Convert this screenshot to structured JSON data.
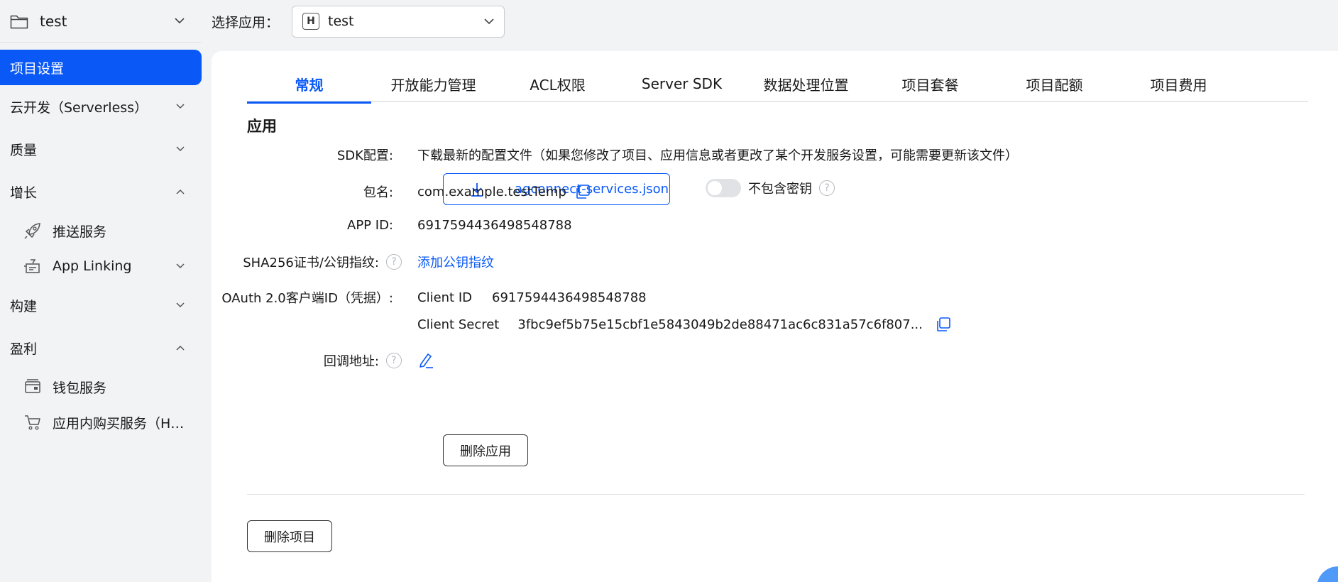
{
  "sidebar": {
    "project_name": "test",
    "items": [
      {
        "label": "项目设置",
        "active": true
      },
      {
        "label": "云开发（Serverless）",
        "expand": "down"
      },
      {
        "label": "质量",
        "expand": "down"
      },
      {
        "label": "增长",
        "expand": "up"
      },
      {
        "label": "推送服务",
        "icon": "rocket-icon"
      },
      {
        "label": "App Linking",
        "icon": "link-app-icon",
        "expand": "down"
      },
      {
        "label": "构建",
        "expand": "down"
      },
      {
        "label": "盈利",
        "expand": "up"
      },
      {
        "label": "钱包服务",
        "icon": "wallet-icon"
      },
      {
        "label": "应用内购买服务（Ha...",
        "icon": "cart-icon"
      }
    ]
  },
  "topbar": {
    "select_label": "选择应用：",
    "app_badge": "H",
    "app_value": "test"
  },
  "tabs": [
    "常规",
    "开放能力管理",
    "ACL权限",
    "Server SDK",
    "数据处理位置",
    "项目套餐",
    "项目配额",
    "项目费用"
  ],
  "app_section": {
    "title": "应用",
    "sdk_label": "SDK配置:",
    "sdk_desc": "下载最新的配置文件（如果您修改了项目、应用信息或者更改了某个开发服务设置，可能需要更新该文件）",
    "download_label": "agconnect-services.json",
    "toggle_label": "不包含密钥",
    "toggle_on": false,
    "package_label": "包名:",
    "package_value": "com.example.testTemp",
    "appid_label": "APP ID:",
    "appid_value": "6917594436498548788",
    "sha_label": "SHA256证书/公钥指纹:",
    "sha_link": "添加公钥指纹",
    "oauth_label": "OAuth 2.0客户端ID（凭据）:",
    "client_id_label": "Client ID",
    "client_id_value": "6917594436498548788",
    "client_secret_label": "Client Secret",
    "client_secret_value": "3fbc9ef5b75e15cbf1e5843049b2de88471ac6c831a57c6f807...",
    "callback_label": "回调地址:",
    "delete_app": "删除应用"
  },
  "delete_project": "删除项目",
  "colors": {
    "accent": "#0a59f7",
    "bg": "#f1f3f5"
  }
}
